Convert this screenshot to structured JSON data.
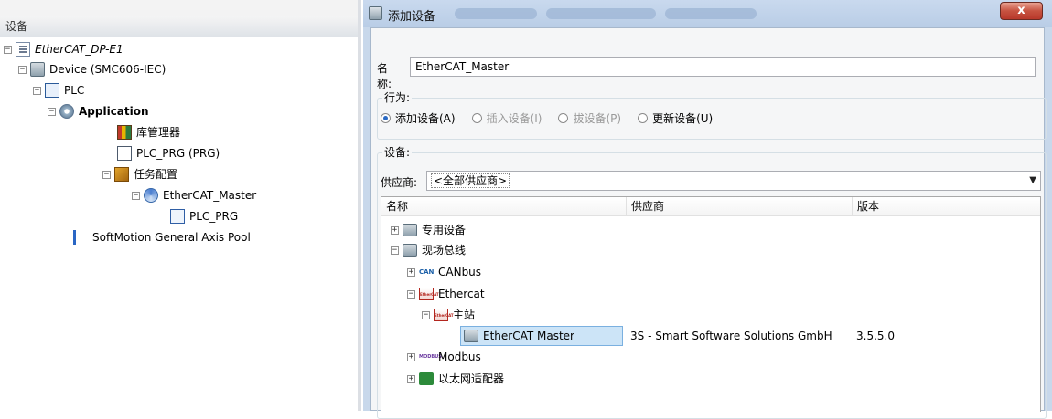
{
  "left_panel": {
    "header": "设备",
    "tree": [
      {
        "label": "EtherCAT_DP-E1",
        "icon": "project-icon"
      },
      {
        "label": "Device (SMC606-IEC)",
        "icon": "device-icon"
      },
      {
        "label": "PLC",
        "icon": "plc-icon"
      },
      {
        "label": "Application",
        "icon": "application-icon"
      },
      {
        "label": "库管理器",
        "icon": "library-icon"
      },
      {
        "label": "PLC_PRG (PRG)",
        "icon": "program-icon"
      },
      {
        "label": "任务配置",
        "icon": "task-icon"
      },
      {
        "label": "EtherCAT_Master",
        "icon": "ethercat-task-icon"
      },
      {
        "label": "PLC_PRG",
        "icon": "call-icon"
      },
      {
        "label": "SoftMotion General Axis Pool",
        "icon": "axis-pool-icon"
      }
    ]
  },
  "dialog": {
    "title": "添加设备",
    "close": "x",
    "name_label": "名称:",
    "name_value": "EtherCAT_Master",
    "behavior_label": "行为:",
    "radios": [
      {
        "label": "添加设备(A)",
        "checked": true,
        "enabled": true
      },
      {
        "label": "插入设备(I)",
        "checked": false,
        "enabled": false
      },
      {
        "label": "拔设备(P)",
        "checked": false,
        "enabled": false
      },
      {
        "label": "更新设备(U)",
        "checked": false,
        "enabled": true
      }
    ],
    "device_label": "设备:",
    "vendor_label": "供应商:",
    "vendor_value": "<全部供应商>",
    "columns": [
      "名称",
      "供应商",
      "版本"
    ],
    "rows": [
      {
        "label": "专用设备",
        "icon": "device-icon",
        "expander": "+"
      },
      {
        "label": "现场总线",
        "icon": "device-icon",
        "expander": "-"
      },
      {
        "label": "CANbus",
        "icon": "can-icon",
        "badge": "CAN",
        "expander": "+"
      },
      {
        "label": "Ethercat",
        "icon": "ethercat-icon",
        "badge": "EtherCAT",
        "expander": "-"
      },
      {
        "label": "主站",
        "icon": "ethercat-icon",
        "badge": "EtherCAT",
        "expander": "-"
      },
      {
        "label": "EtherCAT Master",
        "icon": "device-icon",
        "vendor": "3S - Smart Software Solutions GmbH",
        "version": "3.5.5.0",
        "selected": true
      },
      {
        "label": "Modbus",
        "icon": "modbus-icon",
        "badge": "MODBUS",
        "expander": "+"
      },
      {
        "label": "以太网适配器",
        "icon": "ethernet-adapter-icon",
        "expander": "+"
      }
    ]
  }
}
